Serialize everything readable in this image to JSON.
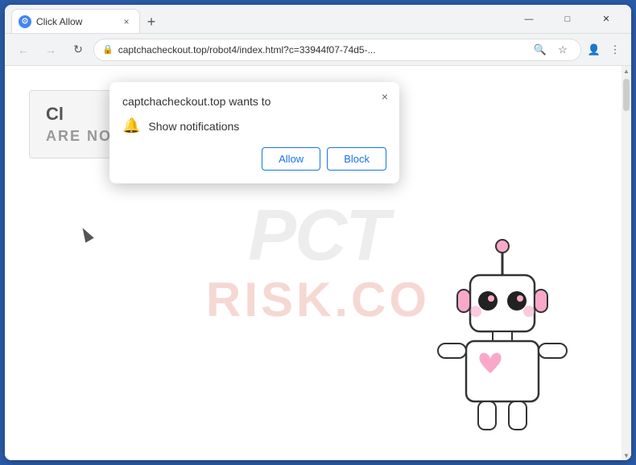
{
  "browser": {
    "title": "Click Allow",
    "tab": {
      "favicon": "⊙",
      "title": "Click Allow",
      "close": "×"
    },
    "new_tab": "+",
    "window_controls": {
      "minimize": "—",
      "maximize": "□",
      "close": "✕"
    }
  },
  "toolbar": {
    "back": "←",
    "forward": "→",
    "refresh": "↻",
    "address": "captchacheckout.top/robot4/index.html?c=33944f07-74d5-...",
    "lock_icon": "🔒",
    "search_icon": "🔍",
    "bookmark_icon": "☆",
    "profile_icon": "👤",
    "menu_icon": "⋮"
  },
  "notification_dialog": {
    "site": "captchacheckout.top wants to",
    "notification_text": "Show notifications",
    "allow_label": "Allow",
    "block_label": "Block",
    "close_label": "×"
  },
  "page": {
    "captcha_title": "Cl",
    "captcha_subtitle": "ARE NOT A ROBOT?",
    "watermark_pct": "PCT",
    "watermark_risk": "RISK.CO"
  }
}
